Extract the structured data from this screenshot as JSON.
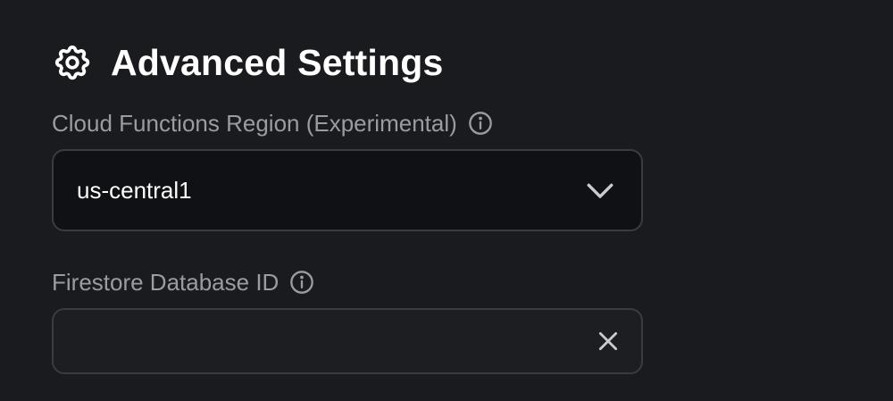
{
  "header": {
    "title": "Advanced Settings",
    "icon": "gear-icon"
  },
  "cloud_functions_region": {
    "label": "Cloud Functions Region (Experimental)",
    "info_icon": "info-icon",
    "selected_value": "us-central1",
    "dropdown_icon": "chevron-down-icon"
  },
  "firestore_database_id": {
    "label": "Firestore Database ID",
    "info_icon": "info-icon",
    "value": "",
    "placeholder": "",
    "clear_icon": "close-icon"
  },
  "colors": {
    "background": "#1a1b1e",
    "label_text": "#9a9ca1",
    "field_border": "#3a3c42",
    "select_background": "#0f1114",
    "input_background": "#1c1e22"
  }
}
